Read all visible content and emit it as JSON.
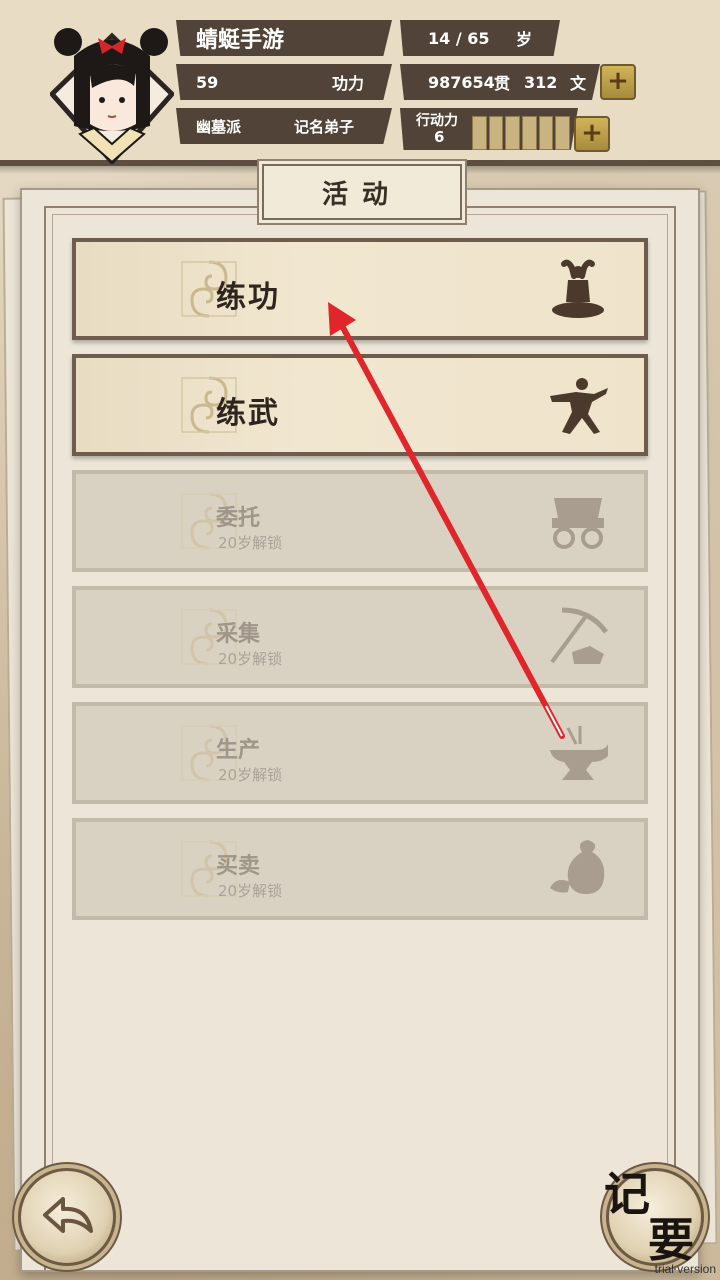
{
  "header": {
    "player_name": "蜻蜓手游",
    "age": "14 / 65",
    "age_unit": "岁",
    "power_value": "59",
    "power_label": "功力",
    "money_guan": "987654",
    "money_guan_unit": "贯",
    "money_wen": "312",
    "money_wen_unit": "文",
    "sect": "幽墓派",
    "rank": "记名弟子",
    "stamina_label": "行动力",
    "stamina_value": "6",
    "plus_glyph": "+"
  },
  "panel": {
    "title": "活动"
  },
  "activities": [
    {
      "title": "练功",
      "subtitle": "",
      "icon": "meditation-icon",
      "locked": false
    },
    {
      "title": "练武",
      "subtitle": "",
      "icon": "martial-arts-icon",
      "locked": false
    },
    {
      "title": "委托",
      "subtitle": "20岁解锁",
      "icon": "cart-icon",
      "locked": true
    },
    {
      "title": "采集",
      "subtitle": "20岁解锁",
      "icon": "pickaxe-icon",
      "locked": true
    },
    {
      "title": "生产",
      "subtitle": "20岁解锁",
      "icon": "anvil-icon",
      "locked": true
    },
    {
      "title": "买卖",
      "subtitle": "20岁解锁",
      "icon": "money-bag-icon",
      "locked": true
    }
  ],
  "footer": {
    "notes_line1": "记",
    "notes_line2": "要",
    "trial_text": "trial version"
  },
  "colors": {
    "header_bar": "#514337",
    "annotation_arrow": "#e0262b"
  }
}
